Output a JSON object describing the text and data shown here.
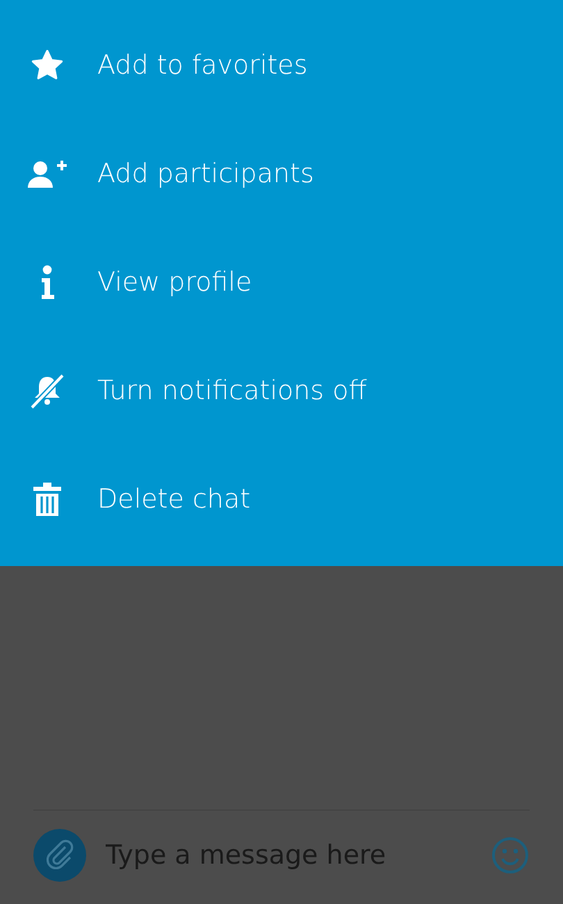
{
  "menu": {
    "items": [
      {
        "kind": "star",
        "label": "Add to favorites"
      },
      {
        "kind": "add-person",
        "label": "Add participants"
      },
      {
        "kind": "info",
        "label": "View profile"
      },
      {
        "kind": "bell-off",
        "label": "Turn notifications off"
      },
      {
        "kind": "trash",
        "label": "Delete chat"
      }
    ]
  },
  "composer": {
    "placeholder": "Type a message here"
  }
}
